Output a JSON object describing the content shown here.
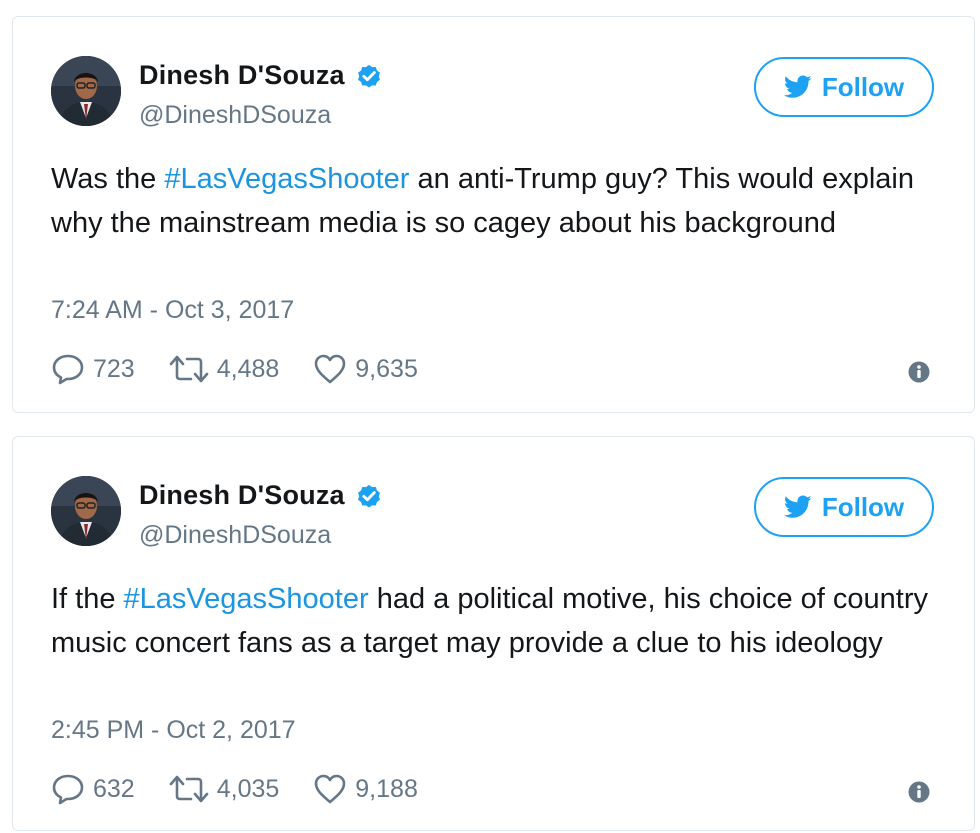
{
  "colors": {
    "accent": "#1da1f2",
    "hashtag": "#1b95e0",
    "muted": "#657786",
    "text": "#14171a",
    "border": "#e1e8ed"
  },
  "tweets": [
    {
      "author": {
        "name": "Dinesh D'Souza",
        "handle": "@DineshDSouza",
        "verified": true,
        "avatar_icon": "profile-photo"
      },
      "follow_label": "Follow",
      "text_before": "Was the ",
      "hashtag": "#LasVegasShooter",
      "text_after": " an anti-Trump guy? This would explain why the mainstream media is so cagey about his background",
      "timestamp": "7:24 AM - Oct 3, 2017",
      "stats": {
        "replies": "723",
        "retweets": "4,488",
        "likes": "9,635"
      }
    },
    {
      "author": {
        "name": "Dinesh D'Souza",
        "handle": "@DineshDSouza",
        "verified": true,
        "avatar_icon": "profile-photo"
      },
      "follow_label": "Follow",
      "text_before": "If the ",
      "hashtag": "#LasVegasShooter",
      "text_after": " had a political motive, his choice of country music concert fans as a target may provide a clue to his ideology",
      "timestamp": "2:45 PM - Oct 2, 2017",
      "stats": {
        "replies": "632",
        "retweets": "4,035",
        "likes": "9,188"
      }
    }
  ]
}
